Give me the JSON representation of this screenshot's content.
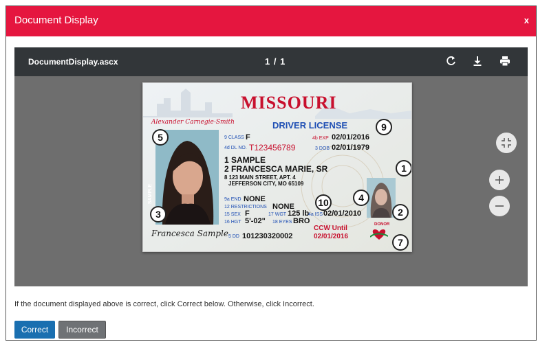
{
  "dialog": {
    "title": "Document Display",
    "close_label": "x"
  },
  "viewer": {
    "file_name": "DocumentDisplay.ascx",
    "page_indicator": "1 / 1"
  },
  "license": {
    "state": "MISSOURI",
    "type": "DRIVER LICENSE",
    "signature_top": "Alexander Carnegie-Smith",
    "class_label": "9 CLASS",
    "class_value": "F",
    "dl_label": "4d DL NO.",
    "dl_value": "T123456789",
    "exp_label": "4b EXP",
    "exp_value": "02/01/2016",
    "dob_label": "3 DOB",
    "dob_value": "02/01/1979",
    "last_name": "1 SAMPLE",
    "first_name": "2 FRANCESCA MARIE, SR",
    "address1": "8 123 MAIN STREET, APT. 4",
    "address2": "JEFFERSON CITY, MO 65109",
    "end_label": "9a END",
    "end_value": "NONE",
    "restr_label": "12 RESTRICTIONS",
    "restr_value": "NONE",
    "sex_label": "15 SEX",
    "sex_value": "F",
    "wgt_label": "17 WGT",
    "wgt_value": "125 lb",
    "iss_label": "4a ISS",
    "iss_value": "02/01/2010",
    "hgt_label": "16 HGT",
    "hgt_value": "5'-02\"",
    "eyes_label": "18 EYES",
    "eyes_value": "BRO",
    "dd_label": "5 DD",
    "dd_value": "101230320002",
    "ccw_line1": "CCW Until",
    "ccw_line2": "02/01/2016",
    "donor": "DONOR",
    "sample_vertical": "SAMPLE",
    "signature_bottom": "Francesca Sample",
    "callouts": [
      "5",
      "9",
      "1",
      "4",
      "10",
      "2",
      "3",
      "7"
    ]
  },
  "message": "If the document displayed above is correct, click Correct below. Otherwise, click Incorrect.",
  "buttons": {
    "correct": "Correct",
    "incorrect": "Incorrect"
  },
  "colors": {
    "header": "#e5163f",
    "toolbar": "#323639",
    "canvas": "#6e6e6e",
    "correct": "#1a6fb0",
    "incorrect": "#6f7275",
    "license_red": "#c8102e",
    "license_blue": "#1f4fb4"
  },
  "icons": {
    "rotate": "rotate-icon",
    "download": "download-icon",
    "print": "print-icon",
    "fit": "fit-page-icon",
    "zoom_in": "zoom-in-icon",
    "zoom_out": "zoom-out-icon"
  }
}
